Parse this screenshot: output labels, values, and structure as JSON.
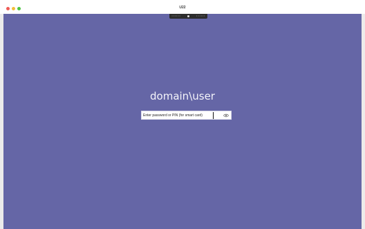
{
  "window": {
    "title": "U22"
  },
  "connection_bar": {
    "left_text": "::::::",
    "right_text": "::::::"
  },
  "login": {
    "username": "domain\\user",
    "password_placeholder": "Enter password or PIN (for smart card)",
    "password_value": ""
  },
  "colors": {
    "background": "#6566a6",
    "text": "#f4f4fa"
  },
  "icons": {
    "reveal": "eye-icon",
    "pin": "pin-icon"
  }
}
